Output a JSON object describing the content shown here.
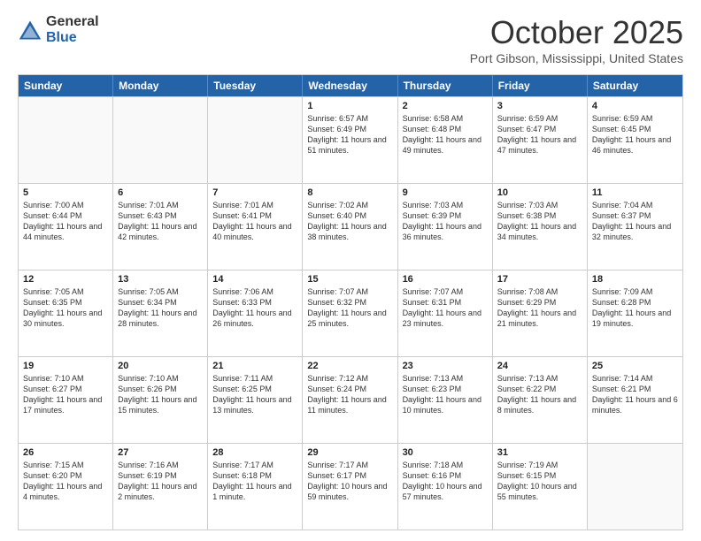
{
  "logo": {
    "general": "General",
    "blue": "Blue"
  },
  "title": "October 2025",
  "location": "Port Gibson, Mississippi, United States",
  "header_days": [
    "Sunday",
    "Monday",
    "Tuesday",
    "Wednesday",
    "Thursday",
    "Friday",
    "Saturday"
  ],
  "rows": [
    [
      {
        "day": "",
        "text": ""
      },
      {
        "day": "",
        "text": ""
      },
      {
        "day": "",
        "text": ""
      },
      {
        "day": "1",
        "text": "Sunrise: 6:57 AM\nSunset: 6:49 PM\nDaylight: 11 hours and 51 minutes."
      },
      {
        "day": "2",
        "text": "Sunrise: 6:58 AM\nSunset: 6:48 PM\nDaylight: 11 hours and 49 minutes."
      },
      {
        "day": "3",
        "text": "Sunrise: 6:59 AM\nSunset: 6:47 PM\nDaylight: 11 hours and 47 minutes."
      },
      {
        "day": "4",
        "text": "Sunrise: 6:59 AM\nSunset: 6:45 PM\nDaylight: 11 hours and 46 minutes."
      }
    ],
    [
      {
        "day": "5",
        "text": "Sunrise: 7:00 AM\nSunset: 6:44 PM\nDaylight: 11 hours and 44 minutes."
      },
      {
        "day": "6",
        "text": "Sunrise: 7:01 AM\nSunset: 6:43 PM\nDaylight: 11 hours and 42 minutes."
      },
      {
        "day": "7",
        "text": "Sunrise: 7:01 AM\nSunset: 6:41 PM\nDaylight: 11 hours and 40 minutes."
      },
      {
        "day": "8",
        "text": "Sunrise: 7:02 AM\nSunset: 6:40 PM\nDaylight: 11 hours and 38 minutes."
      },
      {
        "day": "9",
        "text": "Sunrise: 7:03 AM\nSunset: 6:39 PM\nDaylight: 11 hours and 36 minutes."
      },
      {
        "day": "10",
        "text": "Sunrise: 7:03 AM\nSunset: 6:38 PM\nDaylight: 11 hours and 34 minutes."
      },
      {
        "day": "11",
        "text": "Sunrise: 7:04 AM\nSunset: 6:37 PM\nDaylight: 11 hours and 32 minutes."
      }
    ],
    [
      {
        "day": "12",
        "text": "Sunrise: 7:05 AM\nSunset: 6:35 PM\nDaylight: 11 hours and 30 minutes."
      },
      {
        "day": "13",
        "text": "Sunrise: 7:05 AM\nSunset: 6:34 PM\nDaylight: 11 hours and 28 minutes."
      },
      {
        "day": "14",
        "text": "Sunrise: 7:06 AM\nSunset: 6:33 PM\nDaylight: 11 hours and 26 minutes."
      },
      {
        "day": "15",
        "text": "Sunrise: 7:07 AM\nSunset: 6:32 PM\nDaylight: 11 hours and 25 minutes."
      },
      {
        "day": "16",
        "text": "Sunrise: 7:07 AM\nSunset: 6:31 PM\nDaylight: 11 hours and 23 minutes."
      },
      {
        "day": "17",
        "text": "Sunrise: 7:08 AM\nSunset: 6:29 PM\nDaylight: 11 hours and 21 minutes."
      },
      {
        "day": "18",
        "text": "Sunrise: 7:09 AM\nSunset: 6:28 PM\nDaylight: 11 hours and 19 minutes."
      }
    ],
    [
      {
        "day": "19",
        "text": "Sunrise: 7:10 AM\nSunset: 6:27 PM\nDaylight: 11 hours and 17 minutes."
      },
      {
        "day": "20",
        "text": "Sunrise: 7:10 AM\nSunset: 6:26 PM\nDaylight: 11 hours and 15 minutes."
      },
      {
        "day": "21",
        "text": "Sunrise: 7:11 AM\nSunset: 6:25 PM\nDaylight: 11 hours and 13 minutes."
      },
      {
        "day": "22",
        "text": "Sunrise: 7:12 AM\nSunset: 6:24 PM\nDaylight: 11 hours and 11 minutes."
      },
      {
        "day": "23",
        "text": "Sunrise: 7:13 AM\nSunset: 6:23 PM\nDaylight: 11 hours and 10 minutes."
      },
      {
        "day": "24",
        "text": "Sunrise: 7:13 AM\nSunset: 6:22 PM\nDaylight: 11 hours and 8 minutes."
      },
      {
        "day": "25",
        "text": "Sunrise: 7:14 AM\nSunset: 6:21 PM\nDaylight: 11 hours and 6 minutes."
      }
    ],
    [
      {
        "day": "26",
        "text": "Sunrise: 7:15 AM\nSunset: 6:20 PM\nDaylight: 11 hours and 4 minutes."
      },
      {
        "day": "27",
        "text": "Sunrise: 7:16 AM\nSunset: 6:19 PM\nDaylight: 11 hours and 2 minutes."
      },
      {
        "day": "28",
        "text": "Sunrise: 7:17 AM\nSunset: 6:18 PM\nDaylight: 11 hours and 1 minute."
      },
      {
        "day": "29",
        "text": "Sunrise: 7:17 AM\nSunset: 6:17 PM\nDaylight: 10 hours and 59 minutes."
      },
      {
        "day": "30",
        "text": "Sunrise: 7:18 AM\nSunset: 6:16 PM\nDaylight: 10 hours and 57 minutes."
      },
      {
        "day": "31",
        "text": "Sunrise: 7:19 AM\nSunset: 6:15 PM\nDaylight: 10 hours and 55 minutes."
      },
      {
        "day": "",
        "text": ""
      }
    ]
  ]
}
